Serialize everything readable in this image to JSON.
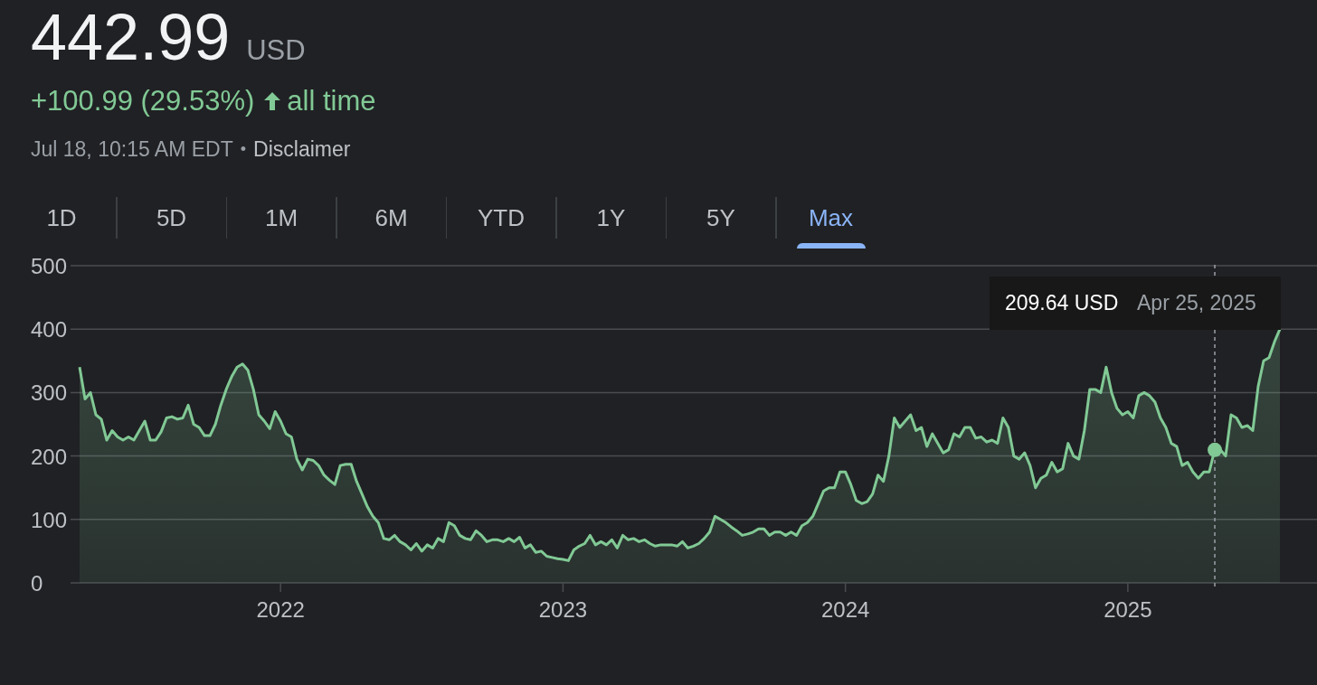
{
  "quote": {
    "price": "442.99",
    "currency": "USD",
    "change": "+100.99 (29.53%)",
    "period": "all time",
    "timestamp": "Jul 18, 10:15 AM EDT",
    "separator": "•",
    "disclaimer": "Disclaimer"
  },
  "tabs": [
    {
      "label": "1D",
      "selected": false
    },
    {
      "label": "5D",
      "selected": false
    },
    {
      "label": "1M",
      "selected": false
    },
    {
      "label": "6M",
      "selected": false
    },
    {
      "label": "YTD",
      "selected": false
    },
    {
      "label": "1Y",
      "selected": false
    },
    {
      "label": "5Y",
      "selected": false
    },
    {
      "label": "Max",
      "selected": true
    }
  ],
  "chart": {
    "tooltip": {
      "value": "209.64 USD",
      "date": "Apr 25, 2025"
    },
    "chart_data": {
      "type": "area",
      "grid": true,
      "ylim": [
        0,
        500
      ],
      "categories": [
        null,
        null,
        null,
        null,
        null,
        null,
        null,
        null,
        null,
        null,
        null,
        null,
        null,
        null,
        null,
        null,
        null,
        null,
        null,
        null,
        null,
        null,
        null,
        null,
        null,
        null,
        null,
        null,
        null,
        null,
        null,
        null,
        null,
        null,
        null,
        null,
        null,
        "2022",
        null,
        null,
        null,
        null,
        null,
        null,
        null,
        null,
        null,
        null,
        null,
        null,
        null,
        null,
        null,
        null,
        null,
        null,
        null,
        null,
        null,
        null,
        null,
        null,
        null,
        null,
        null,
        null,
        null,
        null,
        null,
        null,
        null,
        null,
        null,
        null,
        null,
        null,
        null,
        null,
        null,
        null,
        null,
        null,
        null,
        null,
        null,
        null,
        null,
        null,
        null,
        "2023",
        null,
        null,
        null,
        null,
        null,
        null,
        null,
        null,
        null,
        null,
        null,
        null,
        null,
        null,
        null,
        null,
        null,
        null,
        null,
        null,
        null,
        null,
        null,
        null,
        null,
        null,
        null,
        null,
        null,
        null,
        null,
        null,
        null,
        null,
        null,
        null,
        null,
        null,
        null,
        null,
        null,
        null,
        null,
        null,
        null,
        null,
        null,
        null,
        null,
        null,
        null,
        "2024",
        null,
        null,
        null,
        null,
        null,
        null,
        null,
        null,
        null,
        null,
        null,
        null,
        null,
        null,
        null,
        null,
        null,
        null,
        null,
        null,
        null,
        null,
        null,
        null,
        null,
        null,
        null,
        null,
        null,
        null,
        null,
        null,
        null,
        null,
        null,
        null,
        null,
        null,
        null,
        null,
        null,
        null,
        null,
        null,
        null,
        null,
        null,
        null,
        null,
        null,
        null,
        "2025",
        null,
        null,
        null,
        null,
        null,
        null,
        null,
        null,
        null,
        null,
        null,
        null,
        null,
        null,
        null,
        null,
        null,
        null,
        null,
        null,
        null,
        null,
        null,
        null,
        null,
        null,
        null,
        null
      ],
      "yticks": [
        0,
        100,
        200,
        300,
        400,
        500
      ],
      "series": [
        {
          "color": "#81c995",
          "values": [
            340,
            290,
            300,
            265,
            258,
            225,
            240,
            230,
            225,
            230,
            225,
            240,
            255,
            225,
            225,
            238,
            260,
            262,
            258,
            260,
            280,
            250,
            245,
            232,
            232,
            250,
            280,
            305,
            325,
            340,
            345,
            335,
            305,
            265,
            255,
            243,
            270,
            255,
            235,
            230,
            195,
            178,
            195,
            193,
            185,
            170,
            162,
            155,
            185,
            187,
            187,
            160,
            140,
            120,
            105,
            95,
            70,
            68,
            75,
            65,
            60,
            52,
            62,
            50,
            60,
            55,
            70,
            65,
            95,
            90,
            75,
            70,
            68,
            82,
            75,
            65,
            68,
            68,
            65,
            70,
            65,
            72,
            55,
            60,
            48,
            50,
            42,
            40,
            38,
            37,
            35,
            52,
            58,
            62,
            75,
            60,
            65,
            60,
            68,
            55,
            75,
            68,
            70,
            65,
            68,
            62,
            58,
            60,
            60,
            60,
            58,
            65,
            55,
            58,
            62,
            70,
            80,
            105,
            100,
            95,
            88,
            82,
            75,
            77,
            80,
            85,
            85,
            75,
            80,
            80,
            75,
            80,
            75,
            90,
            95,
            105,
            125,
            145,
            150,
            150,
            175,
            175,
            155,
            130,
            125,
            128,
            140,
            170,
            160,
            200,
            260,
            245,
            255,
            265,
            240,
            245,
            215,
            235,
            220,
            205,
            210,
            235,
            230,
            245,
            245,
            228,
            230,
            222,
            225,
            220,
            260,
            245,
            200,
            195,
            205,
            185,
            150,
            165,
            170,
            190,
            175,
            180,
            220,
            200,
            195,
            240,
            305,
            305,
            300,
            340,
            300,
            275,
            265,
            270,
            260,
            295,
            300,
            295,
            285,
            260,
            245,
            220,
            215,
            185,
            190,
            175,
            165,
            175,
            175,
            210,
            210,
            200,
            265,
            260,
            245,
            248,
            240,
            310,
            350,
            355,
            380,
            400
          ]
        }
      ]
    }
  }
}
